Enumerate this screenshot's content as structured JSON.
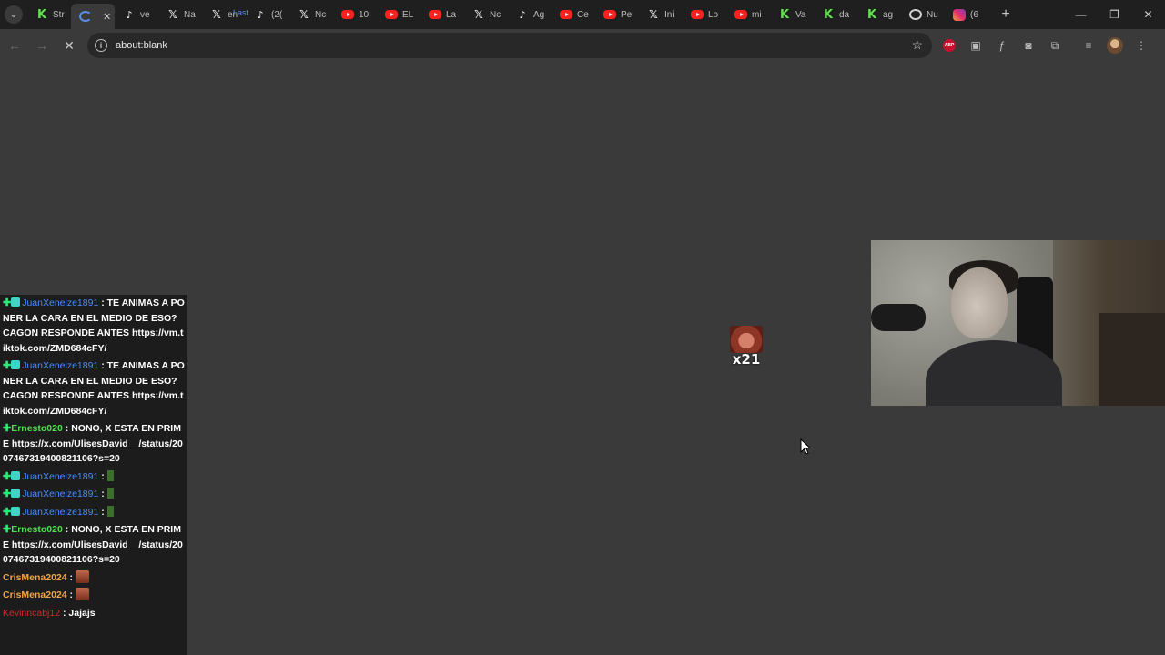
{
  "browser": {
    "tab_overlay_text": "Last",
    "tabs": [
      {
        "label": "Str",
        "icon": "kick-icon"
      },
      {
        "label": "",
        "icon": "loading-icon",
        "active": true,
        "close": "✕"
      },
      {
        "label": "ve",
        "icon": "tiktok-icon"
      },
      {
        "label": "Na",
        "icon": "x-icon"
      },
      {
        "label": "en",
        "icon": "x-icon"
      },
      {
        "label": "(2(",
        "icon": "tiktok-icon"
      },
      {
        "label": "Nc",
        "icon": "x-icon"
      },
      {
        "label": "10",
        "icon": "youtube-icon"
      },
      {
        "label": "EL",
        "icon": "youtube-icon"
      },
      {
        "label": "La",
        "icon": "youtube-icon"
      },
      {
        "label": "Nc",
        "icon": "x-icon"
      },
      {
        "label": "Ag",
        "icon": "tiktok-icon"
      },
      {
        "label": "Ce",
        "icon": "youtube-icon"
      },
      {
        "label": "Pe",
        "icon": "youtube-icon"
      },
      {
        "label": "Ini",
        "icon": "x-icon"
      },
      {
        "label": "Lo",
        "icon": "youtube-icon"
      },
      {
        "label": "mi",
        "icon": "youtube-icon"
      },
      {
        "label": "Va",
        "icon": "kick-icon"
      },
      {
        "label": "da",
        "icon": "kick-icon"
      },
      {
        "label": "ag",
        "icon": "kick-icon"
      },
      {
        "label": "Nu",
        "icon": "github-icon"
      },
      {
        "label": "(6",
        "icon": "instagram-icon"
      }
    ],
    "new_tab": "+",
    "window_controls": {
      "minimize": "—",
      "restore": "❐",
      "close": "✕"
    },
    "address": "about:blank",
    "nav": {
      "back": "←",
      "forward": "→",
      "reload": "✕"
    }
  },
  "chat": {
    "messages": [
      {
        "user": "JuanXeneize1891",
        "user_class": "u-juan",
        "badges": [
          "mod",
          "sub"
        ],
        "text": "TE ANIMAS A PONER LA CARA EN EL MEDIO DE ESO? CAGON RESPONDE ANTES https://vm.tiktok.com/ZMD684cFY/"
      },
      {
        "user": "JuanXeneize1891",
        "user_class": "u-juan",
        "badges": [
          "mod",
          "sub"
        ],
        "text": "TE ANIMAS A PONER LA CARA EN EL MEDIO DE ESO? CAGON RESPONDE ANTES https://vm.tiktok.com/ZMD684cFY/"
      },
      {
        "user": "Ernesto020",
        "user_class": "u-ernesto",
        "badges": [
          "mod"
        ],
        "text": "NONO, X ESTA EN PRIME https://x.com/UlisesDavid__/status/2007467319400821106?s=20"
      },
      {
        "user": "JuanXeneize1891",
        "user_class": "u-juan",
        "badges": [
          "mod",
          "sub"
        ],
        "text": "",
        "emote": "small"
      },
      {
        "user": "JuanXeneize1891",
        "user_class": "u-juan",
        "badges": [
          "mod",
          "sub"
        ],
        "text": "",
        "emote": "small"
      },
      {
        "user": "JuanXeneize1891",
        "user_class": "u-juan",
        "badges": [
          "mod",
          "sub"
        ],
        "text": "",
        "emote": "small"
      },
      {
        "user": "Ernesto020",
        "user_class": "u-ernesto",
        "badges": [
          "mod"
        ],
        "text": "NONO, X ESTA EN PRIME https://x.com/UlisesDavid__/status/2007467319400821106?s=20"
      },
      {
        "user": "CrisMena2024",
        "user_class": "u-cris",
        "badges": [],
        "text": "",
        "emote": "face"
      },
      {
        "user": "CrisMena2024",
        "user_class": "u-cris",
        "badges": [],
        "text": "",
        "emote": "face"
      },
      {
        "user": "Kevinncabj12",
        "user_class": "u-kev",
        "badges": [],
        "text": "Jajajs"
      }
    ]
  },
  "float_emote": {
    "multiplier": "x21"
  }
}
